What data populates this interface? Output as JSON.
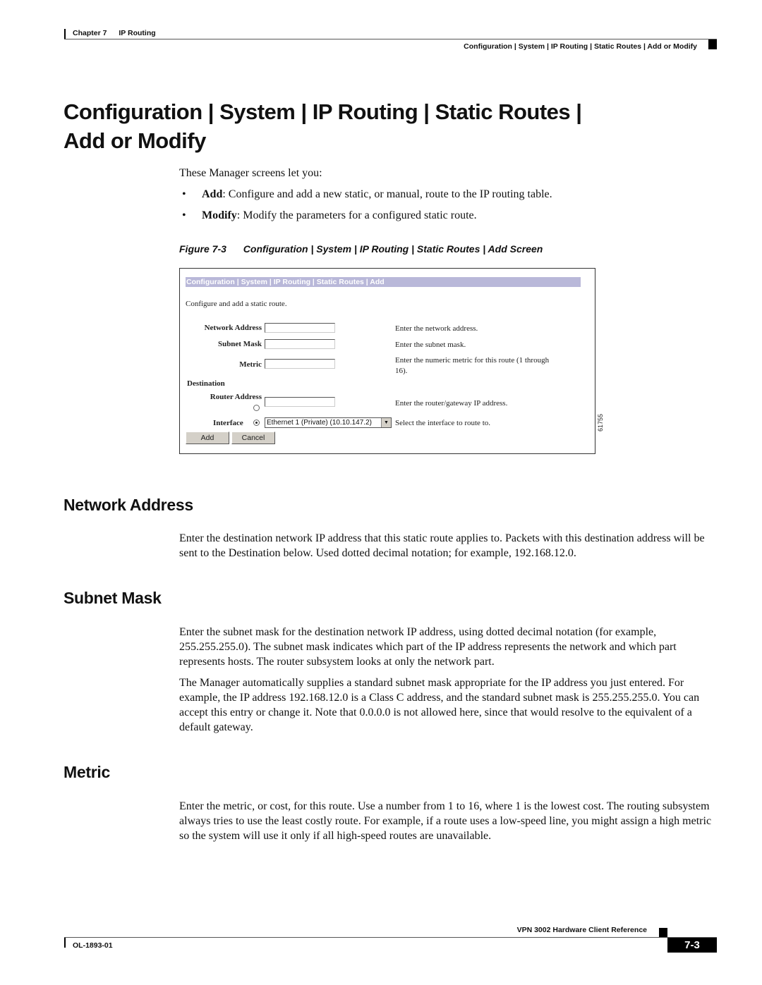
{
  "header": {
    "chapter": "Chapter 7",
    "chapter_title": "IP Routing",
    "section_path": "Configuration | System | IP Routing | Static Routes | Add or Modify"
  },
  "page_title_line1": "Configuration | System | IP Routing | Static Routes |",
  "page_title_line2": "Add or Modify",
  "intro": "These Manager screens let you:",
  "bullets": [
    {
      "term": "Add",
      "text": ": Configure and add a new static, or manual, route to the IP routing table."
    },
    {
      "term": "Modify",
      "text": ": Modify the parameters for a configured static route."
    }
  ],
  "figure": {
    "number": "Figure 7-3",
    "caption": "Configuration | System | IP Routing | Static Routes | Add Screen",
    "id": "61755",
    "screen": {
      "title": "Configuration | System | IP Routing | Static Routes | Add",
      "description": "Configure and add a static route.",
      "fields": {
        "network_address": {
          "label": "Network Address",
          "value": "",
          "help": "Enter the network address."
        },
        "subnet_mask": {
          "label": "Subnet Mask",
          "value": "",
          "help": "Enter the subnet mask."
        },
        "metric": {
          "label": "Metric",
          "value": "",
          "help_line1": "Enter the numeric metric for this route (1 through",
          "help_line2": "16)."
        },
        "destination_heading": "Destination",
        "router_address": {
          "label": "Router Address",
          "value": "",
          "help": "Enter the router/gateway IP address.",
          "selected": false
        },
        "interface": {
          "label": "Interface",
          "value": "Ethernet 1 (Private) (10.10.147.2)",
          "help": "Select the interface to route to.",
          "selected": true
        }
      },
      "buttons": {
        "add": "Add",
        "cancel": "Cancel"
      }
    }
  },
  "sections": {
    "network_address": {
      "heading": "Network Address",
      "paragraphs": [
        "Enter the destination network IP address that this static route applies to. Packets with this destination address will be sent to the Destination below. Used dotted decimal notation; for example, 192.168.12.0."
      ]
    },
    "subnet_mask": {
      "heading": "Subnet Mask",
      "paragraphs": [
        "Enter the subnet mask for the destination network IP address, using dotted decimal notation (for example, 255.255.255.0). The subnet mask indicates which part of the IP address represents the network and which part represents hosts. The router subsystem looks at only the network part.",
        "The Manager automatically supplies a standard subnet mask appropriate for the IP address you just entered. For example, the IP address 192.168.12.0 is a Class C address, and the standard subnet mask is 255.255.255.0. You can accept this entry or change it. Note that 0.0.0.0 is not allowed here, since that would resolve to the equivalent of a default gateway."
      ]
    },
    "metric": {
      "heading": "Metric",
      "paragraphs": [
        "Enter the metric, or cost, for this route. Use a number from 1 to 16, where 1 is the lowest cost. The routing subsystem always tries to use the least costly route. For example, if a route uses a low-speed line, you might assign a high metric so the system will use it only if all high-speed routes are unavailable."
      ]
    }
  },
  "footer": {
    "book_title": "VPN 3002 Hardware Client Reference",
    "doc_number": "OL-1893-01",
    "page_number": "7-3"
  }
}
